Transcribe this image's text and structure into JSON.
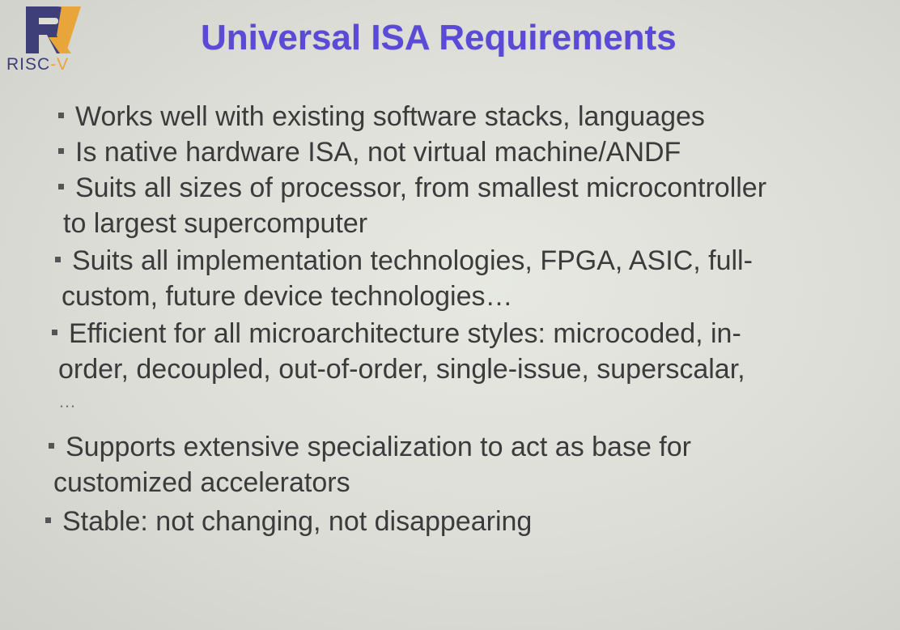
{
  "logo": {
    "text_main": "RISC",
    "text_v": "-V"
  },
  "title": "Universal ISA Requirements",
  "bullets": [
    {
      "lines": [
        "Works well with existing software stacks, languages"
      ]
    },
    {
      "lines": [
        "Is native hardware ISA, not virtual machine/ANDF"
      ]
    },
    {
      "lines": [
        "Suits all sizes of processor, from smallest microcontroller",
        "to largest supercomputer"
      ]
    },
    {
      "lines": [
        "Suits all implementation technologies, FPGA, ASIC, full-",
        "custom, future device technologies…"
      ]
    },
    {
      "lines": [
        "Efficient for all microarchitecture styles: microcoded, in-",
        "order, decoupled, out-of-order, single-issue, superscalar,",
        "…"
      ]
    },
    {
      "lines": [
        "Supports extensive specialization to act as base for",
        "customized accelerators"
      ]
    },
    {
      "lines": [
        "Stable: not changing, not disappearing"
      ]
    }
  ],
  "colors": {
    "title": "#5a4ad6",
    "logo_blue": "#3e3e78",
    "logo_gold": "#e8a63a",
    "text": "#3b3b3b"
  }
}
